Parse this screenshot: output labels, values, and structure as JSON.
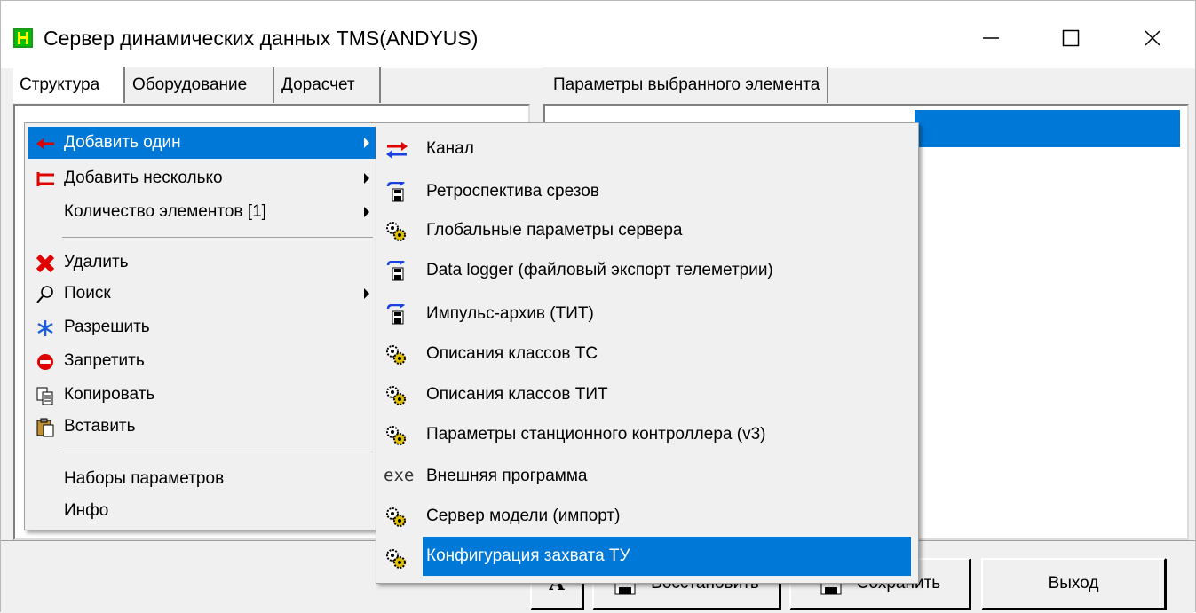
{
  "window": {
    "title": "Сервер динамических данных TMS(ANDYUS)",
    "accent": "#0078d7"
  },
  "left_tabs": [
    {
      "label": "Структура",
      "active": true
    },
    {
      "label": "Оборудование",
      "active": false
    },
    {
      "label": "Дорасчет",
      "active": false
    }
  ],
  "right_tab": {
    "label": "Параметры выбранного элемента"
  },
  "context_menu": {
    "items": [
      {
        "label": "Добавить один",
        "icon": "arrow-left-red-icon",
        "submenu": true,
        "highlighted": true
      },
      {
        "label": "Добавить несколько",
        "icon": "double-arrow-red-icon",
        "submenu": true
      },
      {
        "label": "Количество элементов [1]",
        "icon": "",
        "submenu": true
      },
      {
        "label": "Удалить",
        "icon": "delete-x-icon"
      },
      {
        "label": "Поиск",
        "icon": "magnifier-icon",
        "submenu": true
      },
      {
        "label": "Разрешить",
        "icon": "asterisk-icon"
      },
      {
        "label": "Запретить",
        "icon": "no-entry-icon"
      },
      {
        "label": "Копировать",
        "icon": "copy-icon"
      },
      {
        "label": "Вставить",
        "icon": "paste-icon"
      },
      {
        "label": "Наборы параметров",
        "icon": ""
      },
      {
        "label": "Инфо",
        "icon": ""
      }
    ]
  },
  "submenu": {
    "items": [
      {
        "label": "Канал",
        "icon": "channel-arrows-icon"
      },
      {
        "label": "Ретроспектива срезов",
        "icon": "disk-save-icon"
      },
      {
        "label": "Глобальные параметры сервера",
        "icon": "gears-icon"
      },
      {
        "label": "Data logger (файловый экспорт телеметрии)",
        "icon": "disk-save-icon"
      },
      {
        "label": "Импульс-архив (ТИТ)",
        "icon": "disk-save-icon"
      },
      {
        "label": "Описания классов ТС",
        "icon": "gears-icon"
      },
      {
        "label": "Описания классов ТИТ",
        "icon": "gears-icon"
      },
      {
        "label": "Параметры станционного контроллера (v3)",
        "icon": "gears-icon"
      },
      {
        "label": "Внешняя программа",
        "icon": "exe-icon",
        "icon_text": "exe"
      },
      {
        "label": "Сервер модели (импорт)",
        "icon": "gears-icon"
      },
      {
        "label": "Конфигурация захвата ТУ",
        "icon": "gears-icon",
        "highlighted": true
      }
    ]
  },
  "buttons": {
    "font_label": "A",
    "restore": "Восстановить",
    "save": "Сохранить",
    "exit": "Выход"
  }
}
